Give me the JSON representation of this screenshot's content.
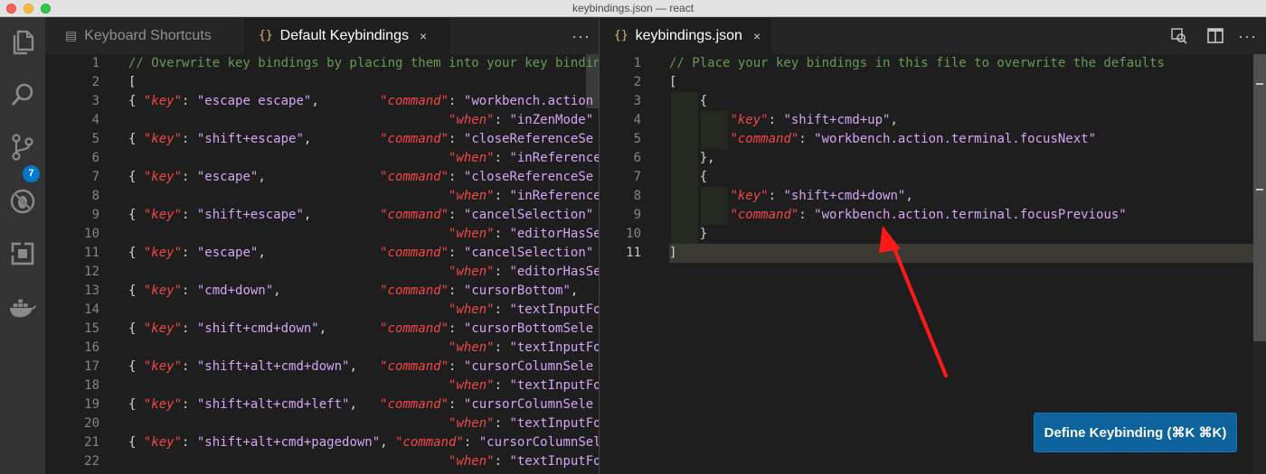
{
  "window": {
    "title": "keybindings.json — react"
  },
  "activity_bar": {
    "items": [
      {
        "name": "explorer-icon"
      },
      {
        "name": "search-icon"
      },
      {
        "name": "source-control-icon"
      },
      {
        "name": "debug-icon"
      },
      {
        "name": "extensions-icon"
      },
      {
        "name": "docker-icon"
      }
    ],
    "scm_badge": "7"
  },
  "left_group": {
    "tabs": [
      {
        "label": "Keyboard Shortcuts",
        "icon": "keyboard-icon",
        "active": false
      },
      {
        "label": "Default Keybindings",
        "icon": "{}",
        "active": true,
        "close": "×"
      }
    ],
    "more": "···",
    "lines": [
      {
        "n": "1",
        "parts": [
          [
            "c",
            "// Overwrite key bindings by placing them into your key bindin"
          ]
        ]
      },
      {
        "n": "2",
        "parts": [
          [
            "p",
            "["
          ]
        ]
      },
      {
        "n": "3",
        "parts": [
          [
            "p",
            "{ "
          ],
          [
            "k",
            "\"key\""
          ],
          [
            "p",
            ": "
          ],
          [
            "s",
            "\"escape escape\""
          ],
          [
            "p",
            ",        "
          ],
          [
            "k",
            "\"command\""
          ],
          [
            "p",
            ": "
          ],
          [
            "s",
            "\"workbench.action"
          ]
        ]
      },
      {
        "n": "4",
        "parts": [
          [
            "p",
            "                                          "
          ],
          [
            "k",
            "\"when\""
          ],
          [
            "p",
            ": "
          ],
          [
            "s",
            "\"inZenMode\""
          ],
          [
            "p",
            " },"
          ]
        ]
      },
      {
        "n": "5",
        "parts": [
          [
            "p",
            "{ "
          ],
          [
            "k",
            "\"key\""
          ],
          [
            "p",
            ": "
          ],
          [
            "s",
            "\"shift+escape\""
          ],
          [
            "p",
            ",         "
          ],
          [
            "k",
            "\"command\""
          ],
          [
            "p",
            ": "
          ],
          [
            "s",
            "\"closeReferenceSe"
          ]
        ]
      },
      {
        "n": "6",
        "parts": [
          [
            "p",
            "                                          "
          ],
          [
            "k",
            "\"when\""
          ],
          [
            "p",
            ": "
          ],
          [
            "s",
            "\"inReferenceSearc"
          ]
        ]
      },
      {
        "n": "7",
        "parts": [
          [
            "p",
            "{ "
          ],
          [
            "k",
            "\"key\""
          ],
          [
            "p",
            ": "
          ],
          [
            "s",
            "\"escape\""
          ],
          [
            "p",
            ",               "
          ],
          [
            "k",
            "\"command\""
          ],
          [
            "p",
            ": "
          ],
          [
            "s",
            "\"closeReferenceSe"
          ]
        ]
      },
      {
        "n": "8",
        "parts": [
          [
            "p",
            "                                          "
          ],
          [
            "k",
            "\"when\""
          ],
          [
            "p",
            ": "
          ],
          [
            "s",
            "\"inReferenceSearc"
          ]
        ]
      },
      {
        "n": "9",
        "parts": [
          [
            "p",
            "{ "
          ],
          [
            "k",
            "\"key\""
          ],
          [
            "p",
            ": "
          ],
          [
            "s",
            "\"shift+escape\""
          ],
          [
            "p",
            ",         "
          ],
          [
            "k",
            "\"command\""
          ],
          [
            "p",
            ": "
          ],
          [
            "s",
            "\"cancelSelection\""
          ]
        ]
      },
      {
        "n": "10",
        "parts": [
          [
            "p",
            "                                          "
          ],
          [
            "k",
            "\"when\""
          ],
          [
            "p",
            ": "
          ],
          [
            "s",
            "\"editorHasSelecti"
          ]
        ]
      },
      {
        "n": "11",
        "parts": [
          [
            "p",
            "{ "
          ],
          [
            "k",
            "\"key\""
          ],
          [
            "p",
            ": "
          ],
          [
            "s",
            "\"escape\""
          ],
          [
            "p",
            ",               "
          ],
          [
            "k",
            "\"command\""
          ],
          [
            "p",
            ": "
          ],
          [
            "s",
            "\"cancelSelection\""
          ]
        ]
      },
      {
        "n": "12",
        "parts": [
          [
            "p",
            "                                          "
          ],
          [
            "k",
            "\"when\""
          ],
          [
            "p",
            ": "
          ],
          [
            "s",
            "\"editorHasSelecti"
          ]
        ]
      },
      {
        "n": "13",
        "parts": [
          [
            "p",
            "{ "
          ],
          [
            "k",
            "\"key\""
          ],
          [
            "p",
            ": "
          ],
          [
            "s",
            "\"cmd+down\""
          ],
          [
            "p",
            ",             "
          ],
          [
            "k",
            "\"command\""
          ],
          [
            "p",
            ": "
          ],
          [
            "s",
            "\"cursorBottom\""
          ],
          [
            "p",
            ","
          ]
        ]
      },
      {
        "n": "14",
        "parts": [
          [
            "p",
            "                                          "
          ],
          [
            "k",
            "\"when\""
          ],
          [
            "p",
            ": "
          ],
          [
            "s",
            "\"textInputFocus\""
          ]
        ]
      },
      {
        "n": "15",
        "parts": [
          [
            "p",
            "{ "
          ],
          [
            "k",
            "\"key\""
          ],
          [
            "p",
            ": "
          ],
          [
            "s",
            "\"shift+cmd+down\""
          ],
          [
            "p",
            ",       "
          ],
          [
            "k",
            "\"command\""
          ],
          [
            "p",
            ": "
          ],
          [
            "s",
            "\"cursorBottomSele"
          ]
        ]
      },
      {
        "n": "16",
        "parts": [
          [
            "p",
            "                                          "
          ],
          [
            "k",
            "\"when\""
          ],
          [
            "p",
            ": "
          ],
          [
            "s",
            "\"textInputFocus\""
          ]
        ]
      },
      {
        "n": "17",
        "parts": [
          [
            "p",
            "{ "
          ],
          [
            "k",
            "\"key\""
          ],
          [
            "p",
            ": "
          ],
          [
            "s",
            "\"shift+alt+cmd+down\""
          ],
          [
            "p",
            ",   "
          ],
          [
            "k",
            "\"command\""
          ],
          [
            "p",
            ": "
          ],
          [
            "s",
            "\"cursorColumnSele"
          ]
        ]
      },
      {
        "n": "18",
        "parts": [
          [
            "p",
            "                                          "
          ],
          [
            "k",
            "\"when\""
          ],
          [
            "p",
            ": "
          ],
          [
            "s",
            "\"textInputFocus\""
          ]
        ]
      },
      {
        "n": "19",
        "parts": [
          [
            "p",
            "{ "
          ],
          [
            "k",
            "\"key\""
          ],
          [
            "p",
            ": "
          ],
          [
            "s",
            "\"shift+alt+cmd+left\""
          ],
          [
            "p",
            ",   "
          ],
          [
            "k",
            "\"command\""
          ],
          [
            "p",
            ": "
          ],
          [
            "s",
            "\"cursorColumnSele"
          ]
        ]
      },
      {
        "n": "20",
        "parts": [
          [
            "p",
            "                                          "
          ],
          [
            "k",
            "\"when\""
          ],
          [
            "p",
            ": "
          ],
          [
            "s",
            "\"textInputFocus\""
          ]
        ]
      },
      {
        "n": "21",
        "parts": [
          [
            "p",
            "{ "
          ],
          [
            "k",
            "\"key\""
          ],
          [
            "p",
            ": "
          ],
          [
            "s",
            "\"shift+alt+cmd+pagedown\""
          ],
          [
            "p",
            ", "
          ],
          [
            "k",
            "\"command\""
          ],
          [
            "p",
            ": "
          ],
          [
            "s",
            "\"cursorColumnSel"
          ]
        ]
      },
      {
        "n": "22",
        "parts": [
          [
            "p",
            "                                          "
          ],
          [
            "k",
            "\"when\""
          ],
          [
            "p",
            ": "
          ],
          [
            "s",
            "\"textInputFocus\""
          ]
        ]
      }
    ]
  },
  "right_group": {
    "tabs": [
      {
        "label": "keybindings.json",
        "icon": "{}",
        "active": true,
        "close": "×"
      }
    ],
    "actions": [
      {
        "name": "open-changes-icon"
      },
      {
        "name": "split-editor-icon"
      },
      {
        "name": "more-actions-icon",
        "text": "···"
      }
    ],
    "current_line": "11",
    "lines": [
      {
        "n": "1",
        "parts": [
          [
            "c",
            "// Place your key bindings in this file to overwrite the defaults"
          ]
        ]
      },
      {
        "n": "2",
        "parts": [
          [
            "p",
            "["
          ]
        ]
      },
      {
        "n": "3",
        "parts": [
          [
            "p",
            "    {"
          ]
        ]
      },
      {
        "n": "4",
        "parts": [
          [
            "p",
            "        "
          ],
          [
            "k",
            "\"key\""
          ],
          [
            "p",
            ": "
          ],
          [
            "s",
            "\"shift+cmd+up\""
          ],
          [
            "p",
            ","
          ]
        ]
      },
      {
        "n": "5",
        "parts": [
          [
            "p",
            "        "
          ],
          [
            "k",
            "\"command\""
          ],
          [
            "p",
            ": "
          ],
          [
            "s",
            "\"workbench.action.terminal.focusNext\""
          ]
        ]
      },
      {
        "n": "6",
        "parts": [
          [
            "p",
            "    },"
          ]
        ]
      },
      {
        "n": "7",
        "parts": [
          [
            "p",
            "    {"
          ]
        ]
      },
      {
        "n": "8",
        "parts": [
          [
            "p",
            "        "
          ],
          [
            "k",
            "\"key\""
          ],
          [
            "p",
            ": "
          ],
          [
            "s",
            "\"shift+cmd+down\""
          ],
          [
            "p",
            ","
          ]
        ]
      },
      {
        "n": "9",
        "parts": [
          [
            "p",
            "        "
          ],
          [
            "k",
            "\"command\""
          ],
          [
            "p",
            ": "
          ],
          [
            "s",
            "\"workbench.action.terminal.focusPrevious\""
          ]
        ]
      },
      {
        "n": "10",
        "parts": [
          [
            "p",
            "    }"
          ]
        ]
      },
      {
        "n": "11",
        "parts": [
          [
            "p",
            "]"
          ]
        ]
      }
    ]
  },
  "define_button": {
    "label": "Define Keybinding (⌘K ⌘K)"
  },
  "annotation": {
    "arrow_color": "#ff1a1a"
  },
  "colors": {
    "accent": "#007acc",
    "comment": "#6a9955",
    "json_key": "#f44747",
    "json_string": "#d4a6f5",
    "button": "#0e639c"
  }
}
